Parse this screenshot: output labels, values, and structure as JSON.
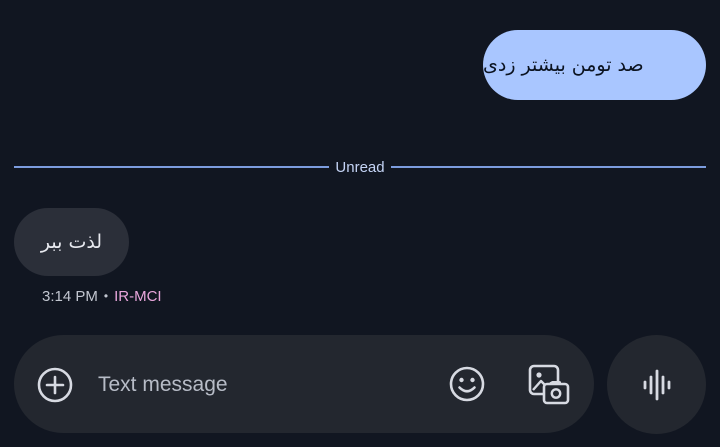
{
  "conversation": {
    "outgoing_message": "صد تومن بیشتر زدی",
    "unread_label": "Unread",
    "incoming_message": "لذت ببر",
    "incoming_time": "3:14 PM",
    "incoming_sim": "IR-MCI"
  },
  "composer": {
    "placeholder": "Text message",
    "add_icon": "plus-circle-icon",
    "emoji_icon": "emoji-icon",
    "media_icon": "gallery-icon",
    "voice_icon": "voice-wave-icon"
  },
  "colors": {
    "background": "#111621",
    "outgoing_bubble": "#a9c6ff",
    "incoming_bubble": "#2b2f39",
    "divider": "#8fb4ff",
    "sim_label": "#e9a6dc",
    "composer_bg": "#23272f"
  }
}
